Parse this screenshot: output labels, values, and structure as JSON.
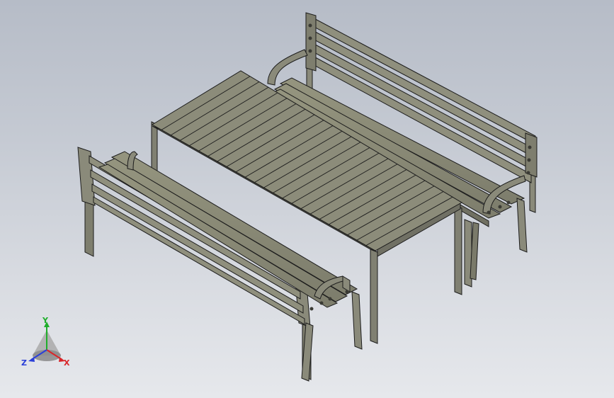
{
  "view": {
    "background_top": "#b6bcc7",
    "background_bottom": "#e6e8ec"
  },
  "model": {
    "part_color": "#8a8a7a",
    "part_edge_color": "#1c1c1c",
    "objects": [
      "table-with-slatted-top",
      "bench-with-backrest-front",
      "bench-with-backrest-rear"
    ]
  },
  "triad": {
    "x_label": "X",
    "y_label": "Y",
    "z_label": "Z",
    "x_color": "#d8262a",
    "y_color": "#1fae2b",
    "z_color": "#2a3fd8"
  }
}
